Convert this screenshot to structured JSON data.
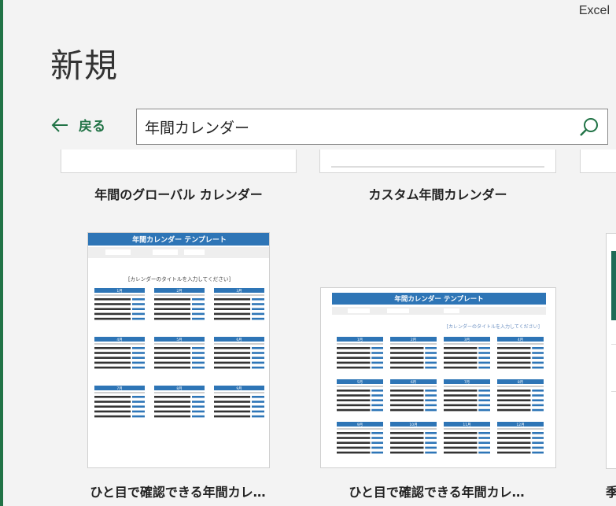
{
  "app": {
    "name": "Excel"
  },
  "page": {
    "title": "新規"
  },
  "nav": {
    "back_label": "戻る"
  },
  "search": {
    "value": "年間カレンダー"
  },
  "templates": [
    {
      "title": "年間のグローバル カレンダー"
    },
    {
      "title": "カスタム年間カレンダー"
    },
    {
      "title": "ひと目で確認できる年間カレ…"
    },
    {
      "title": "ひと目で確認できる年間カレ…"
    },
    {
      "title": "季"
    }
  ],
  "previews": [
    {
      "header": "年間カレンダー テンプレート",
      "subtitle": "[カレンダーのタイトルを入力してください]",
      "months": [
        "1月",
        "2月",
        "3月",
        "4月",
        "5月",
        "6月",
        "7月",
        "8月",
        "9月"
      ]
    },
    {
      "header": "年間カレンダー テンプレート",
      "subtitle": "[カレンダーのタイトルを入力してください]",
      "months": [
        "1月",
        "2月",
        "3月",
        "4月",
        "5月",
        "6月",
        "7月",
        "8月",
        "9月",
        "10月",
        "11月",
        "12月"
      ]
    }
  ],
  "colors": {
    "accent": "#217346",
    "template_blue": "#2e75b6"
  }
}
